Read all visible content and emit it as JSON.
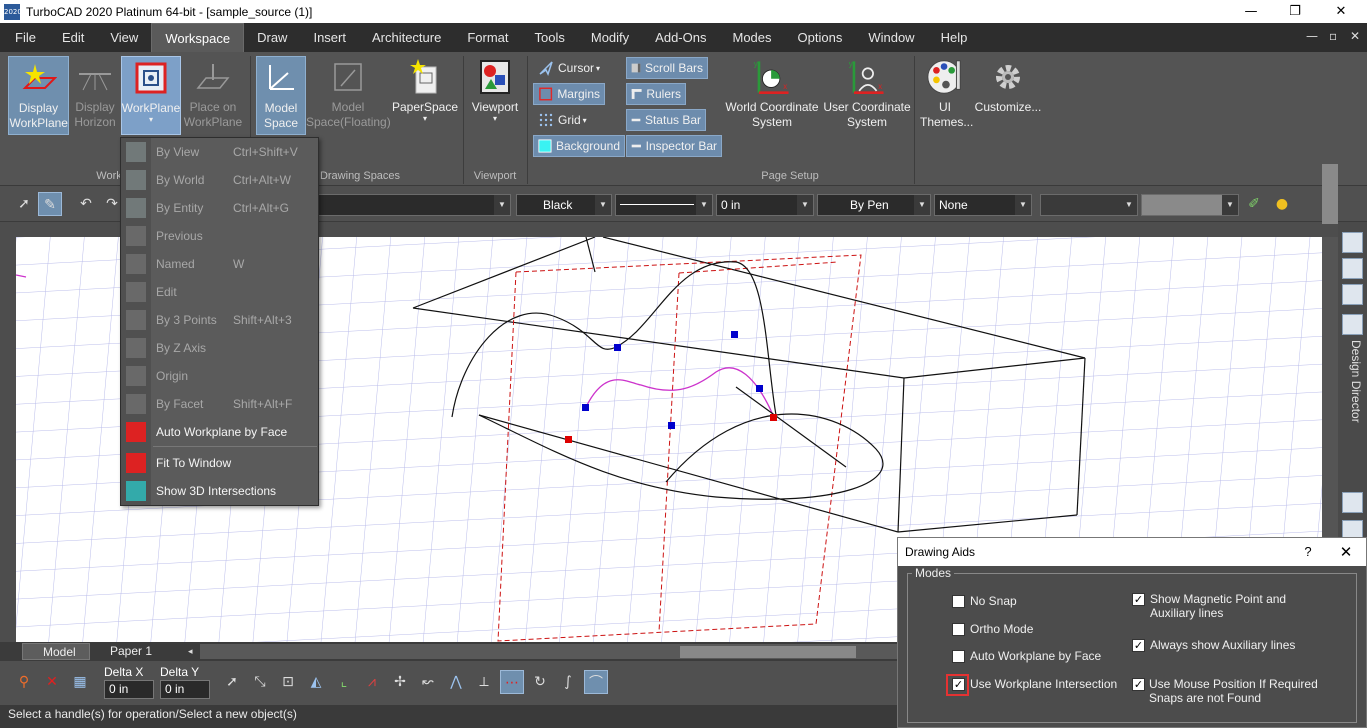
{
  "window": {
    "title": "TurboCAD 2020 Platinum 64-bit - [sample_source (1)]",
    "app_icon_text": "2020",
    "minimize": "—",
    "restore": "❐",
    "close": "✕"
  },
  "menubar": {
    "items": [
      "File",
      "Edit",
      "View",
      "Workspace",
      "Draw",
      "Insert",
      "Architecture",
      "Format",
      "Tools",
      "Modify",
      "Add-Ons",
      "Modes",
      "Options",
      "Window",
      "Help"
    ],
    "active": "Workspace",
    "mdi_controls": [
      "—",
      "▫",
      "✕"
    ]
  },
  "ribbon": {
    "display_workplane": "Display WorkPlane",
    "display_horizon": "Display Horizon",
    "workplane": "WorkPlane",
    "place_on_workplane": "Place on WorkPlane",
    "model_space": "Model Space",
    "model_space_floating": "Model Space(Floating)",
    "paperspace": "PaperSpace",
    "viewport": "Viewport",
    "cursor": "Cursor",
    "margins": "Margins",
    "grid": "Grid",
    "background": "Background",
    "scroll_bars": "Scroll Bars",
    "rulers": "Rulers",
    "status_bar": "Status Bar",
    "inspector_bar": "Inspector Bar",
    "world_cs": "World Coordinate System",
    "user_cs": "User Coordinate System",
    "ui_themes": "UI Themes...",
    "customize": "Customize...",
    "groups": {
      "workplane_partial": "Work",
      "drawing_spaces": "Drawing Spaces",
      "viewport": "Viewport",
      "page_setup": "Page Setup"
    }
  },
  "property_bar": {
    "color": "Black",
    "line_width": "0 in",
    "pen": "By Pen",
    "fill": "None"
  },
  "workplane_menu": {
    "items": [
      {
        "label": "By View",
        "shortcut": "Ctrl+Shift+V",
        "enabled": false
      },
      {
        "label": "By World",
        "shortcut": "Ctrl+Alt+W",
        "enabled": false
      },
      {
        "label": "By Entity",
        "shortcut": "Ctrl+Alt+G",
        "enabled": false
      },
      {
        "label": "Previous",
        "shortcut": "",
        "enabled": false
      },
      {
        "label": "Named",
        "shortcut": "W",
        "enabled": false
      },
      {
        "label": "Edit",
        "shortcut": "",
        "enabled": false
      },
      {
        "label": "By 3 Points",
        "shortcut": "Shift+Alt+3",
        "enabled": false
      },
      {
        "label": "By Z Axis",
        "shortcut": "",
        "enabled": false
      },
      {
        "label": "Origin",
        "shortcut": "",
        "enabled": false
      },
      {
        "label": "By Facet",
        "shortcut": "Shift+Alt+F",
        "enabled": false
      },
      {
        "label": "Auto Workplane by Face",
        "shortcut": "",
        "enabled": true
      },
      {
        "label": "Fit To Window",
        "shortcut": "",
        "enabled": true
      },
      {
        "label": "Show 3D Intersections",
        "shortcut": "",
        "enabled": true
      }
    ]
  },
  "design_director": {
    "label": "Design Director"
  },
  "tabs": {
    "model": "Model",
    "paper": "Paper 1"
  },
  "bottom": {
    "delta_x_label": "Delta X",
    "delta_y_label": "Delta Y",
    "delta_x": "0 in",
    "delta_y": "0 in"
  },
  "status": {
    "text": "Select a handle(s) for operation/Select a new object(s)"
  },
  "drawing_aids": {
    "title": "Drawing Aids",
    "help": "?",
    "close": "✕",
    "group": "Modes",
    "options": [
      {
        "label": "No Snap",
        "checked": false
      },
      {
        "label": "Ortho Mode",
        "checked": false
      },
      {
        "label": "Auto Workplane by Face",
        "checked": false
      },
      {
        "label": "Use Workplane Intersection",
        "checked": true
      },
      {
        "label": "Show Magnetic Point and Auxiliary lines",
        "checked": true
      },
      {
        "label": "Always show Auxiliary lines",
        "checked": true
      },
      {
        "label": "Use Mouse Position If Required Snaps are not  Found",
        "checked": true
      }
    ]
  },
  "colors": {
    "accent_blue": "#6f8fae",
    "curve_magenta": "#cc33cc",
    "red_dashed": "#cc1111",
    "handle_blue": "#0000cc",
    "handle_red": "#dd0000"
  }
}
